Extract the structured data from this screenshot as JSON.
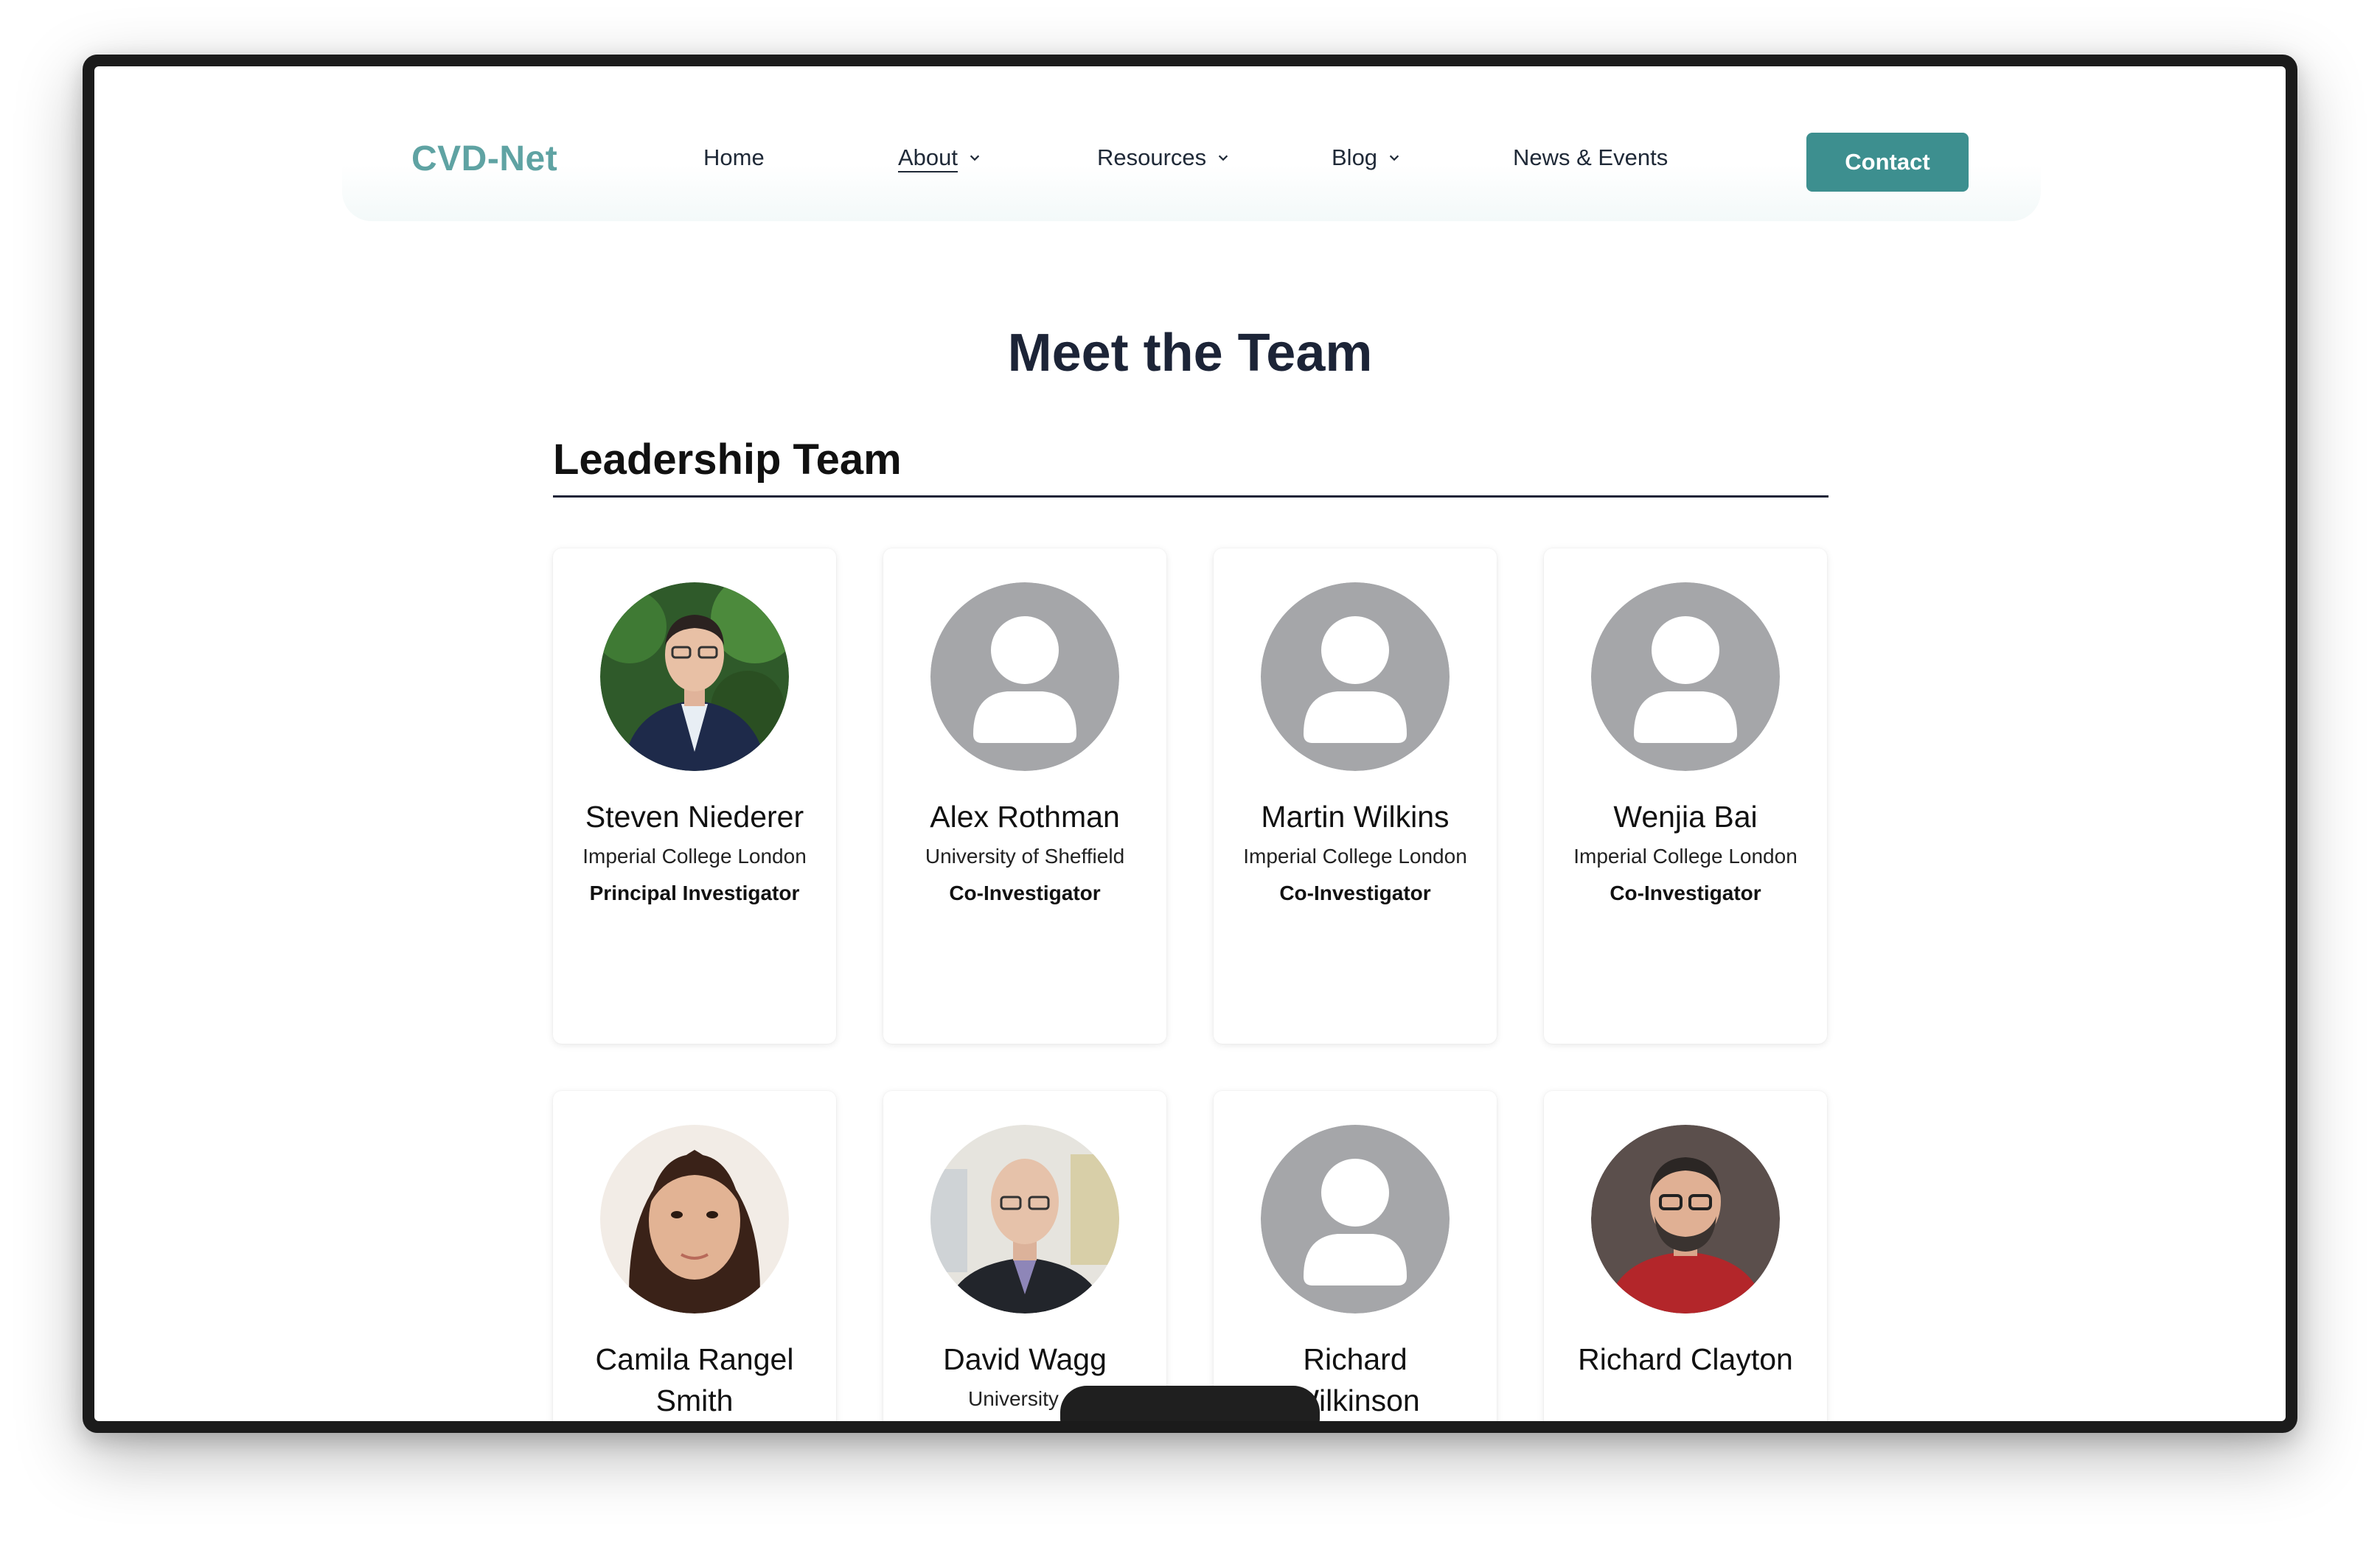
{
  "site": {
    "logo": "CVD-Net",
    "nav": [
      {
        "label": "Home",
        "has_dropdown": false,
        "active": false
      },
      {
        "label": "About",
        "has_dropdown": true,
        "active": true
      },
      {
        "label": "Resources",
        "has_dropdown": true,
        "active": false
      },
      {
        "label": "Blog",
        "has_dropdown": true,
        "active": false
      },
      {
        "label": "News & Events",
        "has_dropdown": false,
        "active": false
      }
    ],
    "contact_label": "Contact",
    "accent_color": "#3d8f8f",
    "logo_color": "#5fa3a3"
  },
  "page": {
    "title": "Meet the Team",
    "section_title": "Leadership Team"
  },
  "team": [
    {
      "name": "Steven Niederer",
      "institution": "Imperial College London",
      "role": "Principal Investigator",
      "photo": "person-photo"
    },
    {
      "name": "Alex Rothman",
      "institution": "University of Sheffield",
      "role": "Co-Investigator",
      "photo": "placeholder-avatar-icon"
    },
    {
      "name": "Martin Wilkins",
      "institution": "Imperial College London",
      "role": "Co-Investigator",
      "photo": "placeholder-avatar-icon"
    },
    {
      "name": "Wenjia Bai",
      "institution": "Imperial College London",
      "role": "Co-Investigator",
      "photo": "placeholder-avatar-icon"
    },
    {
      "name": "Camila Rangel Smith",
      "institution": "",
      "role": "",
      "photo": "person-photo"
    },
    {
      "name": "David Wagg",
      "institution": "University of",
      "role": "",
      "photo": "person-photo"
    },
    {
      "name": "Richard Wilkinson",
      "institution": "",
      "role": "",
      "photo": "placeholder-avatar-icon"
    },
    {
      "name": "Richard Clayton",
      "institution": "",
      "role": "",
      "photo": "person-photo"
    }
  ]
}
